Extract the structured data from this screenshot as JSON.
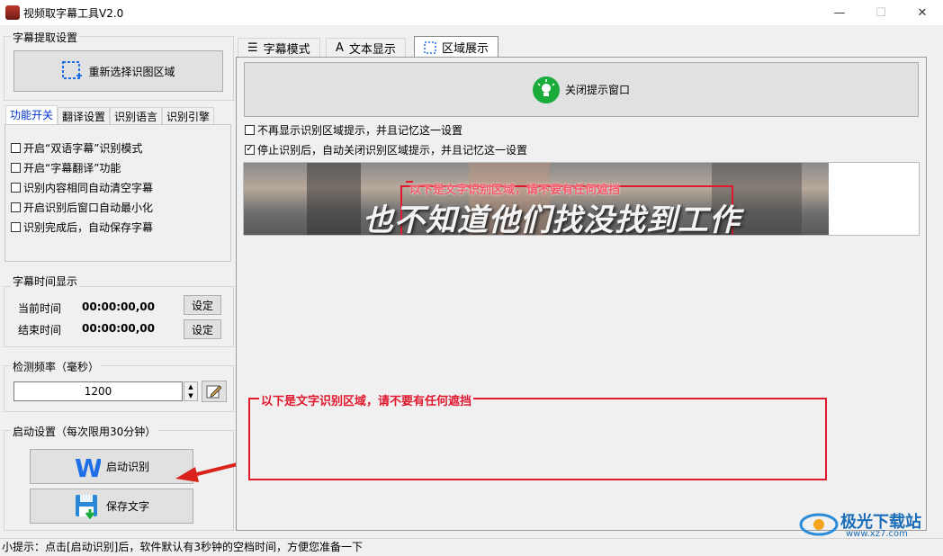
{
  "window": {
    "title": "视频取字幕工具V2.0",
    "minimize_glyph": "—",
    "maximize_glyph": "☐",
    "close_glyph": "✕"
  },
  "left": {
    "extract_group_label": "字幕提取设置",
    "reselect_button": "重新选择识图区域",
    "tabs": [
      "功能开关",
      "翻译设置",
      "识别语言",
      "识别引擎"
    ],
    "options": [
      {
        "label": "开启“双语字幕”识别模式",
        "checked": false
      },
      {
        "label": "开启“字幕翻译”功能",
        "checked": false
      },
      {
        "label": "识别内容相同自动清空字幕",
        "checked": false
      },
      {
        "label": "开启识别后窗口自动最小化",
        "checked": false
      },
      {
        "label": "识别完成后，自动保存字幕",
        "checked": false
      }
    ],
    "time_group_label": "字幕时间显示",
    "current_time_label": "当前时间",
    "current_time_value": "00:00:00,00",
    "end_time_label": "结束时间",
    "end_time_value": "00:00:00,00",
    "set_button": "设定",
    "freq_group_label": "检测频率（毫秒）",
    "freq_value": "1200",
    "start_group_label": "启动设置（每次限用30分钟）",
    "start_button": "启动识别",
    "save_button": "保存文字"
  },
  "right": {
    "tabs": [
      "字幕模式",
      "文本显示",
      "区域展示"
    ],
    "active_tab": "区域展示",
    "close_tip_button": "关闭提示窗口",
    "options": [
      {
        "label": "不再显示识别区域提示，并且记忆这一设置",
        "checked": false
      },
      {
        "label": "停止识别后，自动关闭识别区域提示，并且记忆这一设置",
        "checked": true
      }
    ],
    "preview_notice": "以下是文字识别区域，请不要有任何遮挡",
    "preview_subtitle": "也不知道他们找没找到工作",
    "region_notice": "以下是文字识别区域，请不要有任何遮挡"
  },
  "status": {
    "tip": "小提示：点击[启动识别]后，软件默认有3秒钟的空档时间，方便您准备一下"
  },
  "watermark": {
    "text": "极光下载站",
    "url": "www.xz7.com"
  },
  "colors": {
    "accent_red": "#e0192e",
    "arrow_red": "#d9231c",
    "green": "#1aab3a",
    "select_blue": "#1e6ee8"
  }
}
